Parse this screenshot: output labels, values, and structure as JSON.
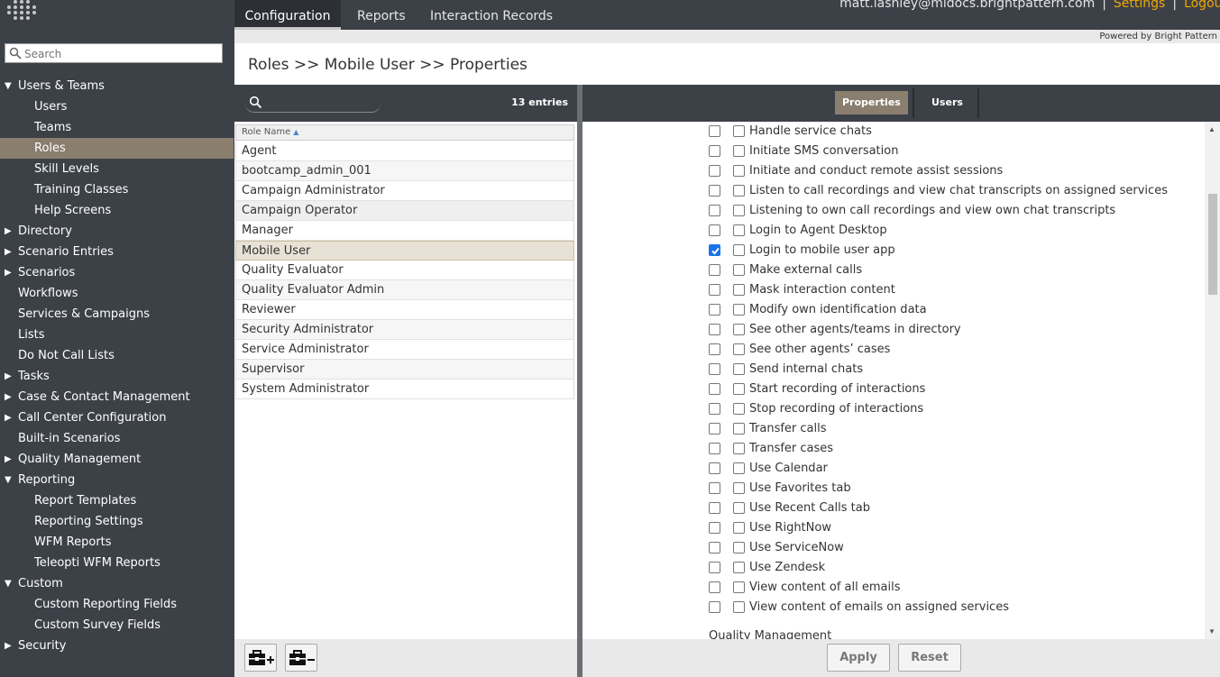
{
  "topbar": {
    "tabs": [
      {
        "label": "Configuration"
      },
      {
        "label": "Reports"
      },
      {
        "label": "Interaction Records"
      }
    ],
    "user": "matt.lashley@mldocs.brightpattern.com",
    "settings": "Settings",
    "logout": "Logout",
    "separator": "|",
    "powered_by": "Powered by Bright Pattern"
  },
  "sidebar": {
    "search_placeholder": "Search",
    "items": [
      {
        "label": "Users & Teams"
      },
      {
        "label": "Users"
      },
      {
        "label": "Teams"
      },
      {
        "label": "Roles"
      },
      {
        "label": "Skill Levels"
      },
      {
        "label": "Training Classes"
      },
      {
        "label": "Help Screens"
      },
      {
        "label": "Directory"
      },
      {
        "label": "Scenario Entries"
      },
      {
        "label": "Scenarios"
      },
      {
        "label": "Workflows"
      },
      {
        "label": "Services & Campaigns"
      },
      {
        "label": "Lists"
      },
      {
        "label": "Do Not Call Lists"
      },
      {
        "label": "Tasks"
      },
      {
        "label": "Case & Contact Management"
      },
      {
        "label": "Call Center Configuration"
      },
      {
        "label": "Built-in Scenarios"
      },
      {
        "label": "Quality Management"
      },
      {
        "label": "Reporting"
      },
      {
        "label": "Report Templates"
      },
      {
        "label": "Reporting Settings"
      },
      {
        "label": "WFM Reports"
      },
      {
        "label": "Teleopti WFM Reports"
      },
      {
        "label": "Custom"
      },
      {
        "label": "Custom Reporting Fields"
      },
      {
        "label": "Custom Survey Fields"
      },
      {
        "label": "Security"
      }
    ]
  },
  "page": {
    "title": "Roles >> Mobile User >> Properties"
  },
  "list": {
    "entries": "13 entries",
    "column": "Role Name",
    "rows": [
      "Agent",
      "bootcamp_admin_001",
      "Campaign Administrator",
      "Campaign Operator",
      "Manager",
      "Mobile User",
      "Quality Evaluator",
      "Quality Evaluator Admin",
      "Reviewer",
      "Security Administrator",
      "Service Administrator",
      "Supervisor",
      "System Administrator"
    ]
  },
  "props": {
    "tabs": [
      {
        "label": "Properties"
      },
      {
        "label": "Users"
      }
    ],
    "permissions": [
      {
        "label": "Handle service chats",
        "checked": false
      },
      {
        "label": "Initiate SMS conversation",
        "checked": false
      },
      {
        "label": "Initiate and conduct remote assist sessions",
        "checked": false
      },
      {
        "label": "Listen to call recordings and view chat transcripts on assigned services",
        "checked": false
      },
      {
        "label": "Listening to own call recordings and view own chat transcripts",
        "checked": false
      },
      {
        "label": "Login to Agent Desktop",
        "checked": false
      },
      {
        "label": "Login to mobile user app",
        "checked": true
      },
      {
        "label": "Make external calls",
        "checked": false
      },
      {
        "label": "Mask interaction content",
        "checked": false
      },
      {
        "label": "Modify own identification data",
        "checked": false
      },
      {
        "label": "See other agents/teams in directory",
        "checked": false
      },
      {
        "label": "See other agents’ cases",
        "checked": false
      },
      {
        "label": "Send internal chats",
        "checked": false
      },
      {
        "label": "Start recording of interactions",
        "checked": false
      },
      {
        "label": "Stop recording of interactions",
        "checked": false
      },
      {
        "label": "Transfer calls",
        "checked": false
      },
      {
        "label": "Transfer cases",
        "checked": false
      },
      {
        "label": "Use Calendar",
        "checked": false
      },
      {
        "label": "Use Favorites tab",
        "checked": false
      },
      {
        "label": "Use Recent Calls tab",
        "checked": false
      },
      {
        "label": "Use RightNow",
        "checked": false
      },
      {
        "label": "Use ServiceNow",
        "checked": false
      },
      {
        "label": "Use Zendesk",
        "checked": false
      },
      {
        "label": "View content of all emails",
        "checked": false
      },
      {
        "label": "View content of emails on assigned services",
        "checked": false
      }
    ],
    "section_title": "Quality Management",
    "apply": "Apply",
    "reset": "Reset"
  },
  "colors": {
    "dark_bar": "#3c4148",
    "selected_nav": "#8a7f6f",
    "link_accent": "#f0a800",
    "checkbox_checked": "#1a73e8"
  }
}
